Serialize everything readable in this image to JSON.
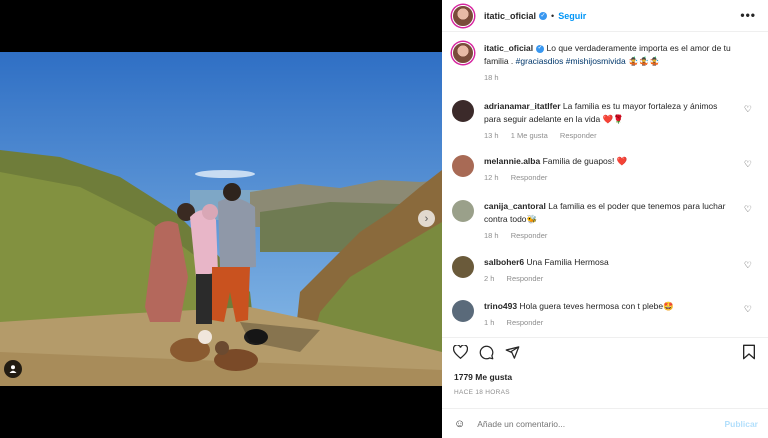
{
  "post": {
    "author": "itatic_oficial",
    "follow_label": "Seguir",
    "more_label": "•••",
    "caption_text": " Lo que verdaderamente importa es el amor de tu familia . ",
    "hashtags": "#graciasdios #mishijosmivida",
    "caption_emoji": "🤹🤹🤹",
    "caption_time": "18 h"
  },
  "comments": [
    {
      "user": "adrianamar_itatlfer",
      "text": " La familia es tu mayor fortaleza y ánimos para seguir adelante en la vida ❤️🌹",
      "time": "13 h",
      "likes": "1 Me gusta",
      "reply": "Responder"
    },
    {
      "user": "melannie.alba",
      "text": " Familia de guapos! ❤️",
      "time": "12 h",
      "reply": "Responder"
    },
    {
      "user": "canija_cantoral",
      "text": " La familia es el poder que tenemos para luchar contra todo🐝",
      "time": "18 h",
      "reply": "Responder"
    },
    {
      "user": "salboher6",
      "text": " Una Familia Hermosa",
      "time": "2 h",
      "reply": "Responder"
    },
    {
      "user": "trino493",
      "text": " Hola guera teves hermosa con t plebe🤩",
      "time": "1 h",
      "reply": "Responder"
    }
  ],
  "actions": {
    "likes": "1779 Me gusta",
    "timestamp": "HACE 18 HORAS",
    "comment_placeholder": "Añade un comentario...",
    "publish_label": "Publicar",
    "emoji_icon": "☺"
  },
  "colors": {
    "accent": "#0095f6",
    "verified": "#3897f0"
  }
}
